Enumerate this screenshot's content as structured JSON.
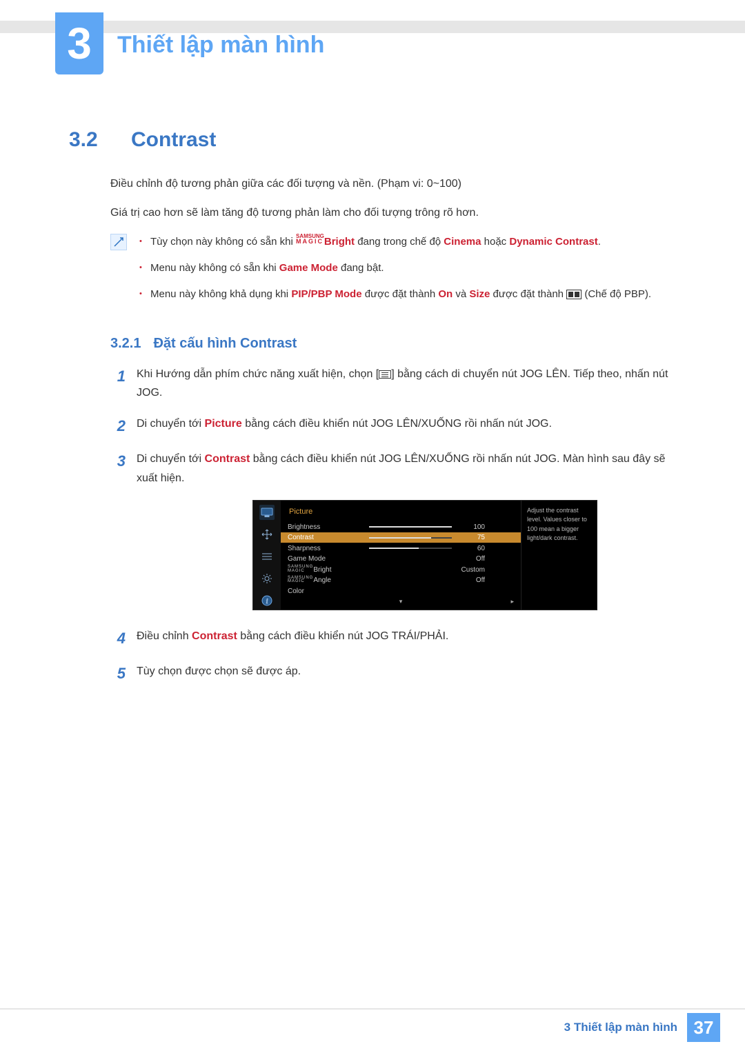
{
  "chapter": {
    "number": "3",
    "title": "Thiết lập màn hình"
  },
  "section": {
    "number": "3.2",
    "title": "Contrast"
  },
  "intro": {
    "p1": "Điều chỉnh độ tương phản giữa các đối tượng và nền. (Phạm vi: 0~100)",
    "p2": "Giá trị cao hơn sẽ làm tăng độ tương phản làm cho đối tượng trông rõ hơn."
  },
  "notes": {
    "n1": {
      "pre": "Tùy chọn này không có sẵn khi ",
      "magic": "SAMSUNG",
      "magic2": "MAGIC",
      "bright": "Bright",
      "mid": " đang trong chế độ ",
      "cinema": "Cinema",
      "or": " hoặc ",
      "dyn": "Dynamic Contrast",
      "end": "."
    },
    "n2": {
      "pre": "Menu này không có sẵn khi ",
      "gm": "Game Mode",
      "end": " đang bật."
    },
    "n3": {
      "pre": "Menu này không khả dụng khi ",
      "pip": "PIP/PBP Mode",
      "mid": " được đặt thành ",
      "on": "On",
      "and": " và ",
      "size": "Size",
      "end": " được đặt thành ",
      "tail": " (Chế độ PBP)."
    }
  },
  "subsection": {
    "number": "3.2.1",
    "title": "Đặt cấu hình Contrast"
  },
  "steps": {
    "s1": "Khi Hướng dẫn phím chức năng xuất hiện, chọn [",
    "s1b": "] bằng cách di chuyển nút JOG LÊN. Tiếp theo, nhấn nút JOG.",
    "s2a": "Di chuyển tới ",
    "s2pic": "Picture",
    "s2b": " bằng cách điều khiển nút JOG LÊN/XUỐNG rồi nhấn nút JOG.",
    "s3a": "Di chuyển tới ",
    "s3c": "Contrast",
    "s3b": " bằng cách điều khiển nút JOG LÊN/XUỐNG rồi nhấn nút JOG. Màn hình sau đây sẽ xuất hiện.",
    "s4a": "Điều chỉnh ",
    "s4c": "Contrast",
    "s4b": " bằng cách điều khiển nút JOG TRÁI/PHẢI.",
    "s5": "Tùy chọn được chọn sẽ được áp."
  },
  "osd": {
    "head": "Picture",
    "rows": [
      {
        "label": "Brightness",
        "slider": 100,
        "val": "100"
      },
      {
        "label": "Contrast",
        "slider": 75,
        "val": "75",
        "sel": true
      },
      {
        "label": "Sharpness",
        "slider": 60,
        "val": "60"
      },
      {
        "label": "Game Mode",
        "val": "Off"
      },
      {
        "label": "Bright",
        "magic": true,
        "val": "Custom"
      },
      {
        "label": "Angle",
        "magic": true,
        "val": "Off"
      },
      {
        "label": "Color",
        "val": ""
      }
    ],
    "help": "Adjust the contrast level. Values closer to 100 mean a bigger light/dark contrast."
  },
  "footer": {
    "text": "3 Thiết lập màn hình",
    "page": "37"
  }
}
